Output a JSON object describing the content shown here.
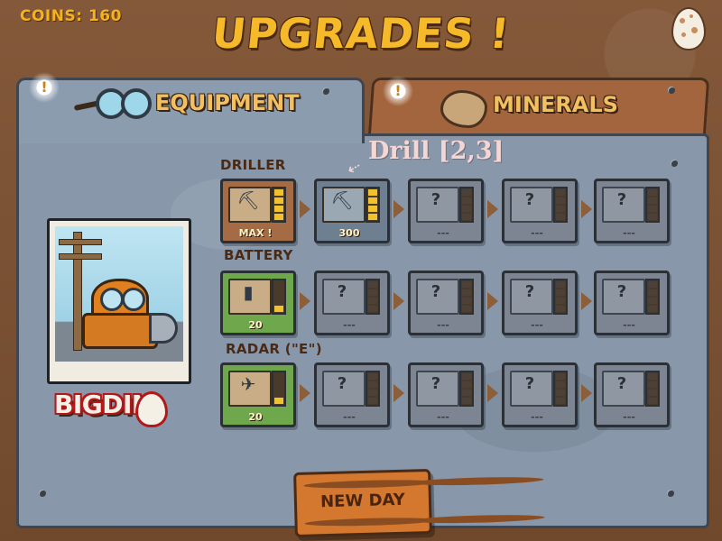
{
  "header": {
    "coins_label": "COINS: 160",
    "title": "UPGRADES !"
  },
  "tabs": [
    {
      "label": "EQUIPMENT",
      "icon": "goggles-icon",
      "active": true
    },
    {
      "label": "MINERALS",
      "icon": "rock-icon",
      "active": false
    }
  ],
  "notification_mark": "!",
  "hint": {
    "text": "Drill [2,3]",
    "arrow": "⇠"
  },
  "character": {
    "logo_text": "BIGDIN"
  },
  "rows": [
    {
      "label": "DRILLER",
      "cards": [
        {
          "state": "maxed",
          "icon": "drill-icon",
          "caption": "MAX !",
          "level": 4
        },
        {
          "state": "available",
          "icon": "drill-icon",
          "caption": "300",
          "level": 4
        },
        {
          "state": "locked",
          "caption": "---",
          "mark": "?"
        },
        {
          "state": "locked",
          "caption": "---",
          "mark": "?"
        },
        {
          "state": "locked",
          "caption": "---",
          "mark": "?"
        }
      ]
    },
    {
      "label": "BATTERY",
      "cards": [
        {
          "state": "buyable",
          "icon": "battery-icon",
          "caption": "20",
          "level": 1
        },
        {
          "state": "locked",
          "caption": "---",
          "mark": "?"
        },
        {
          "state": "locked",
          "caption": "---",
          "mark": "?"
        },
        {
          "state": "locked",
          "caption": "---",
          "mark": "?"
        },
        {
          "state": "locked",
          "caption": "---",
          "mark": "?"
        }
      ]
    },
    {
      "label": "RADAR (\"E\")",
      "cards": [
        {
          "state": "buyable",
          "icon": "radar-icon",
          "caption": "20",
          "level": 1
        },
        {
          "state": "locked",
          "caption": "---",
          "mark": "?"
        },
        {
          "state": "locked",
          "caption": "---",
          "mark": "?"
        },
        {
          "state": "locked",
          "caption": "---",
          "mark": "?"
        },
        {
          "state": "locked",
          "caption": "---",
          "mark": "?"
        }
      ]
    }
  ],
  "footer": {
    "new_day_label": "NEW DAY"
  },
  "colors": {
    "title": "#f5b92a",
    "meter_on": "#f2c12e",
    "card_green": "#6fa84c",
    "card_brown": "#a56b45",
    "card_blue": "#6d7f91",
    "card_locked": "#7c8591",
    "panel": "#8898aa",
    "hint": "#f5d6d4"
  }
}
